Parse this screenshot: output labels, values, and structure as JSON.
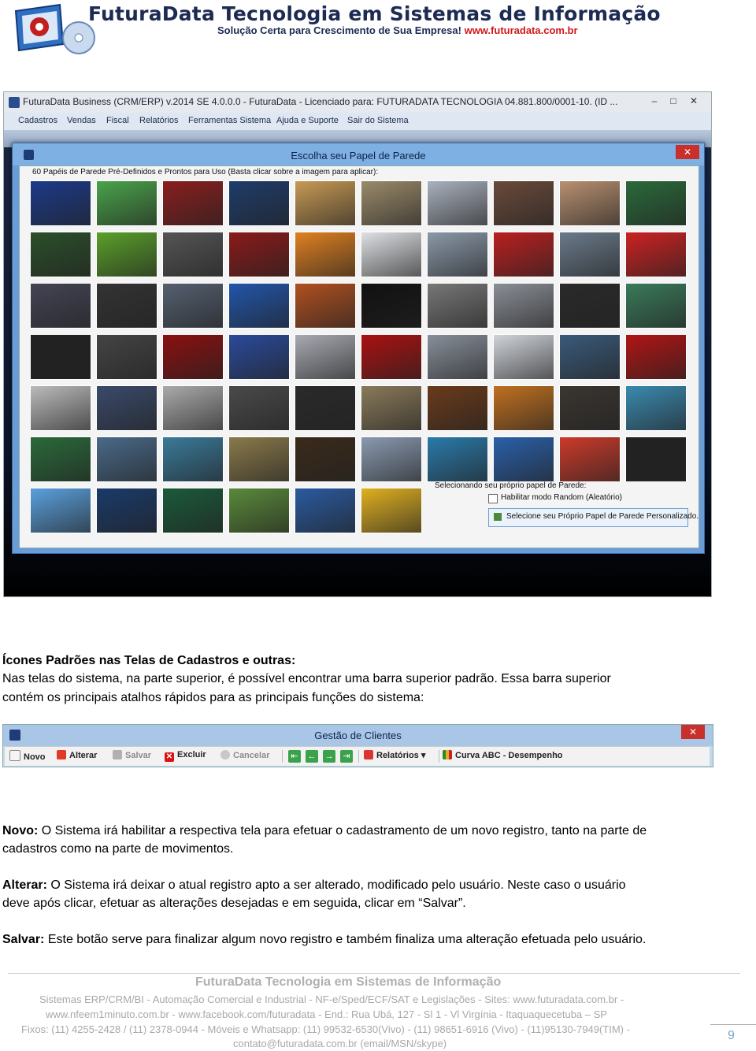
{
  "header": {
    "title": "FuturaData Tecnologia em Sistemas de Informação",
    "subtitle": "Solução Certa para Crescimento de Sua Empresa!",
    "url": "www.futuradata.com.br"
  },
  "screenshot1": {
    "app_title": "FuturaData Business (CRM/ERP) v.2014 SE 4.0.0.0 - FuturaData - Licenciado para: FUTURADATA TECNOLOGIA 04.881.800/0001-10. (ID ...",
    "menu": [
      "Cadastros",
      "Vendas",
      "Fiscal",
      "Relatórios",
      "Ferramentas Sistema",
      "Ajuda e Suporte",
      "Sair do Sistema"
    ],
    "dialog": {
      "title": "Escolha seu Papel de Parede",
      "hint": "60 Papéis de Parede Pré-Definidos e Prontos para Uso (Basta clicar sobre a imagem para aplicar):",
      "custom_label": "Selecionando seu próprio papel de Parede:",
      "random_label": "Habilitar modo Random (Aleatório)",
      "pick_button": "Selecione seu Próprio Papel de Parede Personalizado."
    },
    "thumb_colors": [
      [
        "#1c3a8a",
        "#4aa34a",
        "#8a1e1e",
        "#1f3c6a",
        "#c79a54",
        "#9a8a6a",
        "#a9b1bd",
        "#6a4a3a",
        "#b89070",
        "#2a6a3a"
      ],
      [
        "#2b4f2a",
        "#5aa02a",
        "#555",
        "#8a1a1a",
        "#e08020",
        "#dfe0e4",
        "#8a98a8",
        "#bb2020",
        "#6a7a8a",
        "#cc2222"
      ],
      [
        "#445",
        "#333",
        "#556070",
        "#2255aa",
        "#b05020",
        "#111",
        "#777",
        "#8a8e96",
        "#2a2a2a",
        "#3a7a5a"
      ],
      [
        "#222",
        "#444",
        "#8a1010",
        "#2a4a9a",
        "#a8aab2",
        "#aa1111",
        "#888f9a",
        "#d0d4da",
        "#3a5a7a",
        "#b01515"
      ],
      [
        "#bbb",
        "#3a4a6a",
        "#aaa",
        "#4a4a4a",
        "#2a2a2a",
        "#8a7a5a",
        "#6a3a1a",
        "#c07020",
        "#3a3530",
        "#3a8ab0"
      ],
      [
        "#2a6a3a",
        "#4a6a8a",
        "#3a7a9a",
        "#8a7a4a",
        "#3a2a1a",
        "#8a9ab0",
        "#2a7aaa",
        "#2a60aa",
        "#cc3a2a",
        "#222"
      ],
      [
        "#5aa0dd",
        "#1a3a6a",
        "#1a5a3a",
        "#5a8a3a",
        "#2a5aa0",
        "#e0b020"
      ]
    ]
  },
  "section": {
    "heading": "Ícones Padrões nas Telas de Cadastros e outras:",
    "line1": "Nas telas do sistema, na parte superior, é possível encontrar uma barra superior padrão. Essa barra superior",
    "line2": "contém os principais atalhos rápidos para as principais funções do sistema:"
  },
  "screenshot2": {
    "title": "Gestão de Clientes",
    "buttons": {
      "novo": "Novo",
      "alterar": "Alterar",
      "salvar": "Salvar",
      "excluir": "Excluir",
      "cancelar": "Cancelar",
      "relatorios": "Relatórios",
      "curva": "Curva ABC - Desempenho"
    }
  },
  "descriptions": {
    "novo_term": "Novo:",
    "novo_l1": " O Sistema irá habilitar a respectiva tela para efetuar o cadastramento de um novo registro, tanto na parte de",
    "novo_l2": "cadastros como na parte de movimentos.",
    "alterar_term": "Alterar:",
    "alterar_l1": " O Sistema irá deixar o atual registro apto a ser alterado, modificado pelo usuário. Neste caso o usuário",
    "alterar_l2": "deve após clicar, efetuar as alterações desejadas e em seguida, clicar em “Salvar”.",
    "salvar_term": "Salvar:",
    "salvar_l1": " Este botão serve para finalizar algum novo registro e também finaliza uma alteração efetuada pelo usuário."
  },
  "footer": {
    "title": "FuturaData Tecnologia em Sistemas de Informação",
    "line1": "Sistemas ERP/CRM/BI - Automação Comercial e Industrial - NF-e/Sped/ECF/SAT e Legislações - Sites: www.futuradata.com.br -",
    "line2": "www.nfeem1minuto.com.br - www.facebook.com/futuradata - End.: Rua Ubá, 127 - Sl 1 - Vl Virgínia - Itaquaquecetuba – SP",
    "line3": "Fixos: (11) 4255-2428 / (11) 2378-0944 - Móveis e Whatsapp: (11) 99532-6530(Vivo) - (11) 98651-6916 (Vivo) - (11)95130-7949(TIM) -",
    "line4": "contato@futuradata.com.br (email/MSN/skype)",
    "page": "9"
  }
}
